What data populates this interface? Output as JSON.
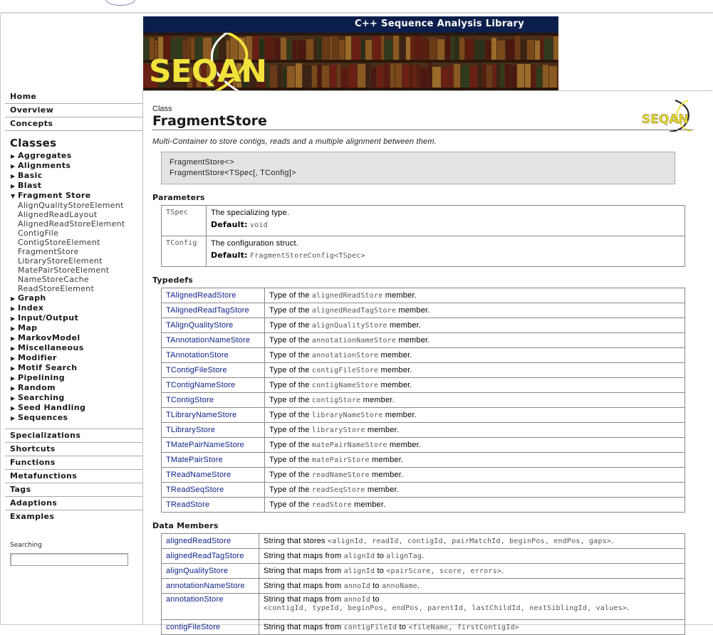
{
  "banner": {
    "title": "C++ Sequence Analysis Library",
    "logo_text": "SEQAN"
  },
  "sidebar": {
    "top_items": [
      "Home",
      "Overview",
      "Concepts"
    ],
    "classes_heading": "Classes",
    "categories_before": [
      "Aggregates",
      "Alignments",
      "Basic",
      "Blast"
    ],
    "expanded_category": "Fragment Store",
    "expanded_items": [
      "AlignQualityStoreElement",
      "AlignedReadLayout",
      "AlignedReadStoreElement",
      "ContigFile",
      "ContigStoreElement",
      "FragmentStore",
      "LibraryStoreElement",
      "MatePairStoreElement",
      "NameStoreCache",
      "ReadStoreElement"
    ],
    "categories_after": [
      "Graph",
      "Index",
      "Input/Output",
      "Map",
      "MarkovModel",
      "Miscellaneous",
      "Modifier",
      "Motif Search",
      "Pipelining",
      "Random",
      "Searching",
      "Seed Handling",
      "Sequences"
    ],
    "bottom_items": [
      "Specializations",
      "Shortcuts",
      "Functions",
      "Metafunctions",
      "Tags",
      "Adaptions",
      "Examples"
    ],
    "search_label": "Searching",
    "search_value": ""
  },
  "page": {
    "type_label": "Class",
    "title": "FragmentStore",
    "summary": "Multi-Container to store contigs, reads and a multiple alignment between them.",
    "signature_lines": [
      "FragmentStore<>",
      "FragmentStore<TSpec[, TConfig]>"
    ],
    "parameters_heading": "Parameters",
    "parameters": [
      {
        "name": "TSpec",
        "desc": "The specializing type.",
        "default_label": "Default:",
        "default_value": "void"
      },
      {
        "name": "TConfig",
        "desc": "The configuration struct.",
        "default_label": "Default:",
        "default_value": "FragmentStoreConfig<TSpec>"
      }
    ],
    "typedefs_heading": "Typedefs",
    "typedefs": [
      {
        "name": "TAlignedReadStore",
        "pre": "Type of the",
        "code": "alignedReadStore",
        "post": "member."
      },
      {
        "name": "TAlignedReadTagStore",
        "pre": "Type of the",
        "code": "alignedReadTagStore",
        "post": "member."
      },
      {
        "name": "TAlignQualityStore",
        "pre": "Type of the",
        "code": "alignQualityStore",
        "post": "member."
      },
      {
        "name": "TAnnotationNameStore",
        "pre": "Type of the",
        "code": "annotationNameStore",
        "post": "member."
      },
      {
        "name": "TAnnotationStore",
        "pre": "Type of the",
        "code": "annotationStore",
        "post": "member."
      },
      {
        "name": "TContigFileStore",
        "pre": "Type of the",
        "code": "contigFileStore",
        "post": "member."
      },
      {
        "name": "TContigNameStore",
        "pre": "Type of the",
        "code": "contigNameStore",
        "post": "member."
      },
      {
        "name": "TContigStore",
        "pre": "Type of the",
        "code": "contigStore",
        "post": "member."
      },
      {
        "name": "TLibraryNameStore",
        "pre": "Type of the",
        "code": "libraryNameStore",
        "post": "member."
      },
      {
        "name": "TLibraryStore",
        "pre": "Type of the",
        "code": "libraryStore",
        "post": "member."
      },
      {
        "name": "TMatePairNameStore",
        "pre": "Type of the",
        "code": "matePairNameStore",
        "post": "member."
      },
      {
        "name": "TMatePairStore",
        "pre": "Type of the",
        "code": "matePairStore",
        "post": "member."
      },
      {
        "name": "TReadNameStore",
        "pre": "Type of the",
        "code": "readNameStore",
        "post": "member."
      },
      {
        "name": "TReadSeqStore",
        "pre": "Type of the",
        "code": "readSeqStore",
        "post": "member."
      },
      {
        "name": "TReadStore",
        "pre": "Type of the",
        "code": "readStore",
        "post": "member."
      }
    ],
    "members_heading": "Data Members",
    "members": [
      {
        "name": "alignedReadStore",
        "pre": "String that stores",
        "code": "<alignId, readId, contigId, pairMatchId, beginPos, endPos, gaps>",
        "post": "."
      },
      {
        "name": "alignedReadTagStore",
        "pre": "String that maps from",
        "code": "alignId",
        "mid": "to",
        "code2": "alignTag",
        "post": "."
      },
      {
        "name": "alignQualityStore",
        "pre": "String that maps from",
        "code": "alignId",
        "mid": "to",
        "code2": "<pairScore, score, errors>",
        "post": "."
      },
      {
        "name": "annotationNameStore",
        "pre": "String that maps from",
        "code": "annoId",
        "mid": "to",
        "code2": "annoName",
        "post": "."
      },
      {
        "name": "annotationStore",
        "pre": "String that maps from",
        "code": "annoId",
        "mid": "to",
        "code2": "<contigId, typeId, beginPos, endPos, parentId, lastChildId, nextSiblingId, values>",
        "post": "."
      },
      {
        "name": "contigFileStore",
        "pre": "String that maps from",
        "code": "contigFileId",
        "mid": "to",
        "code2": "<fileName, firstContigId>",
        "post": ""
      }
    ]
  }
}
